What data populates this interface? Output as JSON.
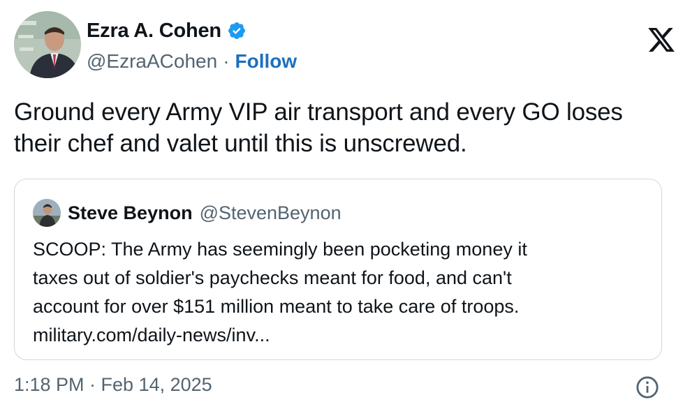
{
  "author": {
    "display_name": "Ezra A. Cohen",
    "handle": "@EzraACohen",
    "separator": "·",
    "follow_label": "Follow"
  },
  "tweet": {
    "text": "Ground every Army VIP air transport and every GO loses their chef and valet until this is unscrewed."
  },
  "quoted_tweet": {
    "display_name": "Steve Beynon",
    "handle": "@StevenBeynon",
    "text_lines": [
      "SCOOP: The Army has seemingly been pocketing money it",
      "taxes out of soldier's paychecks meant for food, and can't",
      "account for over $151 million meant to take care of troops.",
      "military.com/daily-news/inv..."
    ]
  },
  "footer": {
    "timestamp": "1:18 PM · Feb 14, 2025"
  },
  "icons": {
    "verified": "verified-badge-icon",
    "logo": "x-logo-icon",
    "info": "info-icon"
  },
  "colors": {
    "text": "#0f1419",
    "secondary": "#536471",
    "follow": "#1d6fbf",
    "verified": "#1d9bf0",
    "border": "#cfd9de"
  }
}
